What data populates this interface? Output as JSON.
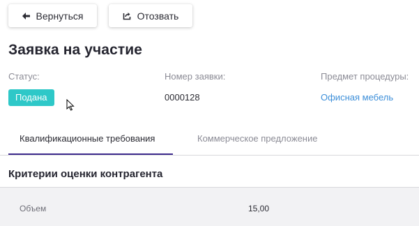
{
  "toolbar": {
    "back_label": "Вернуться",
    "back_icon": "arrow-left-icon",
    "revoke_label": "Отозвать",
    "revoke_icon": "revoke-icon"
  },
  "page_title": "Заявка на участие",
  "info": {
    "status_label": "Статус:",
    "status_value": "Подана",
    "status_color": "#2ec8c8",
    "number_label": "Номер заявки:",
    "number_value": "0000128",
    "subject_label": "Предмет процедуры:",
    "subject_value": "Офисная мебель",
    "link_color": "#3d8fd9"
  },
  "tabs": [
    {
      "label": "Квалификационные требования",
      "active": true
    },
    {
      "label": "Коммерческое предложение",
      "active": false
    }
  ],
  "accent_color": "#3d2a8c",
  "section": {
    "title": "Критерии оценки контрагента",
    "rows": [
      {
        "label": "Объем",
        "value": "15,00"
      }
    ]
  }
}
